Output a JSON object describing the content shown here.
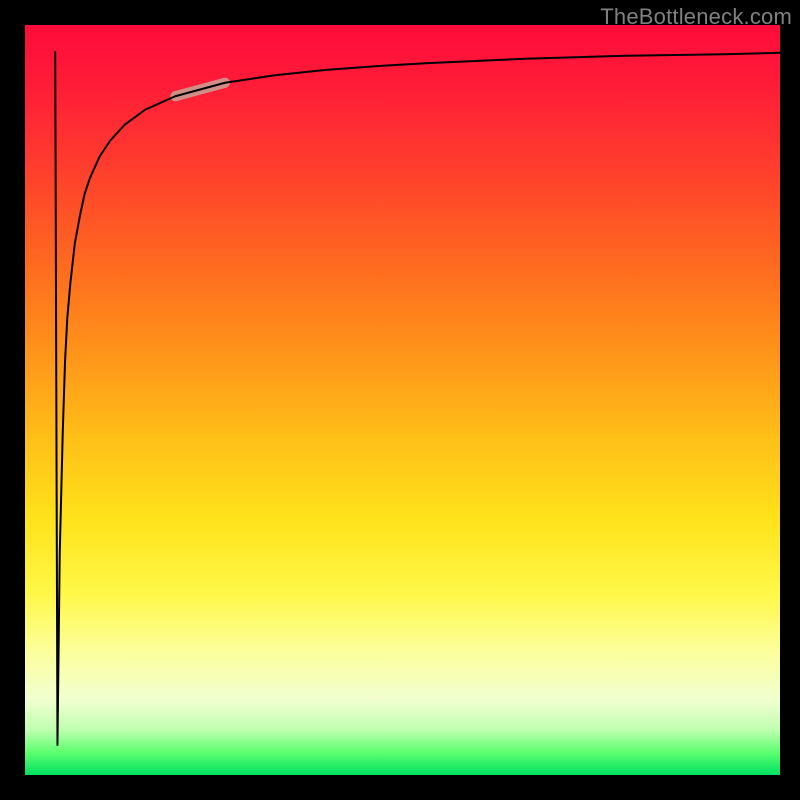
{
  "watermark": {
    "text": "TheBottleneck.com"
  },
  "chart_data": {
    "type": "line",
    "title": "",
    "xlabel": "",
    "ylabel": "",
    "xlim": [
      0,
      100
    ],
    "ylim": [
      0,
      100
    ],
    "background_gradient": {
      "top": "#ff0b3a",
      "mid": "#ffe21a",
      "bottom": "#00e060"
    },
    "highlight_segment": {
      "x_range": [
        18,
        27
      ],
      "y_range": [
        81,
        87
      ],
      "color": "#cf8f87",
      "stroke_width": 10
    },
    "series": [
      {
        "name": "curve",
        "color": "#000000",
        "stroke_width": 2,
        "x": [
          4.0,
          4.3,
          4.6,
          5.0,
          5.3,
          5.6,
          6.0,
          6.6,
          7.3,
          7.9,
          8.6,
          9.9,
          11.3,
          13.2,
          15.9,
          19.9,
          26.5,
          33.1,
          39.7,
          46.4,
          53.0,
          59.6,
          66.2,
          79.5,
          92.7,
          100.0
        ],
        "y": [
          96.4,
          4.0,
          29.5,
          45.7,
          55.1,
          60.9,
          65.5,
          70.9,
          74.7,
          77.5,
          79.6,
          82.5,
          84.6,
          86.7,
          88.7,
          90.5,
          92.3,
          93.3,
          94.0,
          94.5,
          94.9,
          95.2,
          95.5,
          95.9,
          96.1,
          96.3
        ]
      }
    ]
  }
}
